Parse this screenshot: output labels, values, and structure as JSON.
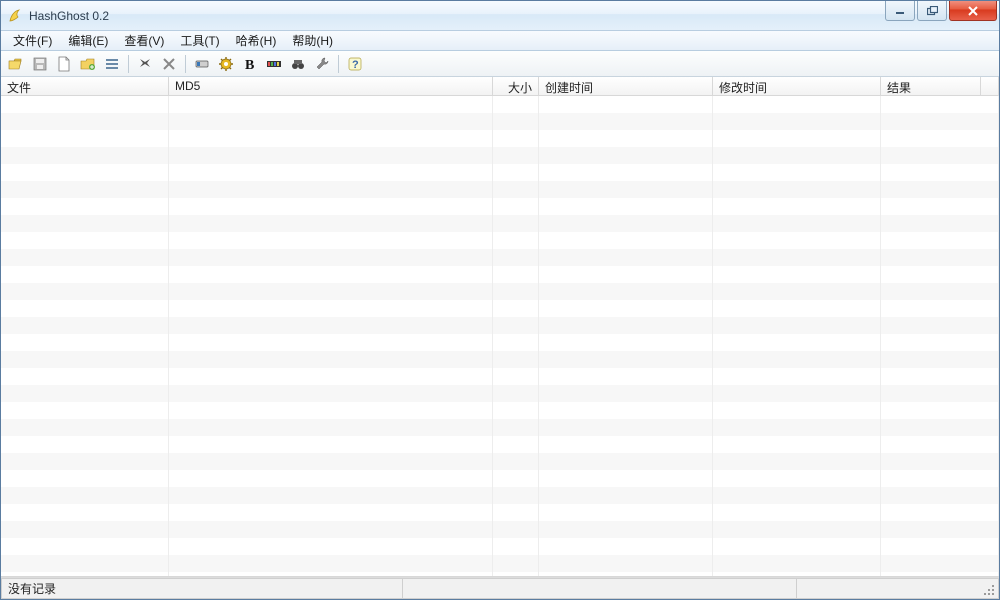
{
  "title": "HashGhost 0.2",
  "menu": {
    "file": "文件(F)",
    "edit": "编辑(E)",
    "view": "查看(V)",
    "tools": "工具(T)",
    "hash": "哈希(H)",
    "help": "帮助(H)"
  },
  "toolbar_icons": {
    "open": "open-icon",
    "save": "save-icon",
    "new": "new-icon",
    "folder": "folder-icon",
    "list": "list-icon",
    "find": "find-icon",
    "clear": "clear-icon",
    "device": "device-icon",
    "gear": "gear-icon",
    "bold": "bold-icon",
    "palette": "palette-icon",
    "binoculars": "binoculars-icon",
    "wrench": "wrench-icon",
    "help": "help-icon"
  },
  "columns": {
    "file": "文件",
    "md5": "MD5",
    "size": "大小",
    "ctime": "创建时间",
    "mtime": "修改时间",
    "result": "结果"
  },
  "rows": [],
  "status": {
    "pane1": "没有记录",
    "pane2": "",
    "pane3": ""
  },
  "colors": {
    "titlebar_text": "#2b3c4d",
    "close_red": "#d83a1e"
  }
}
